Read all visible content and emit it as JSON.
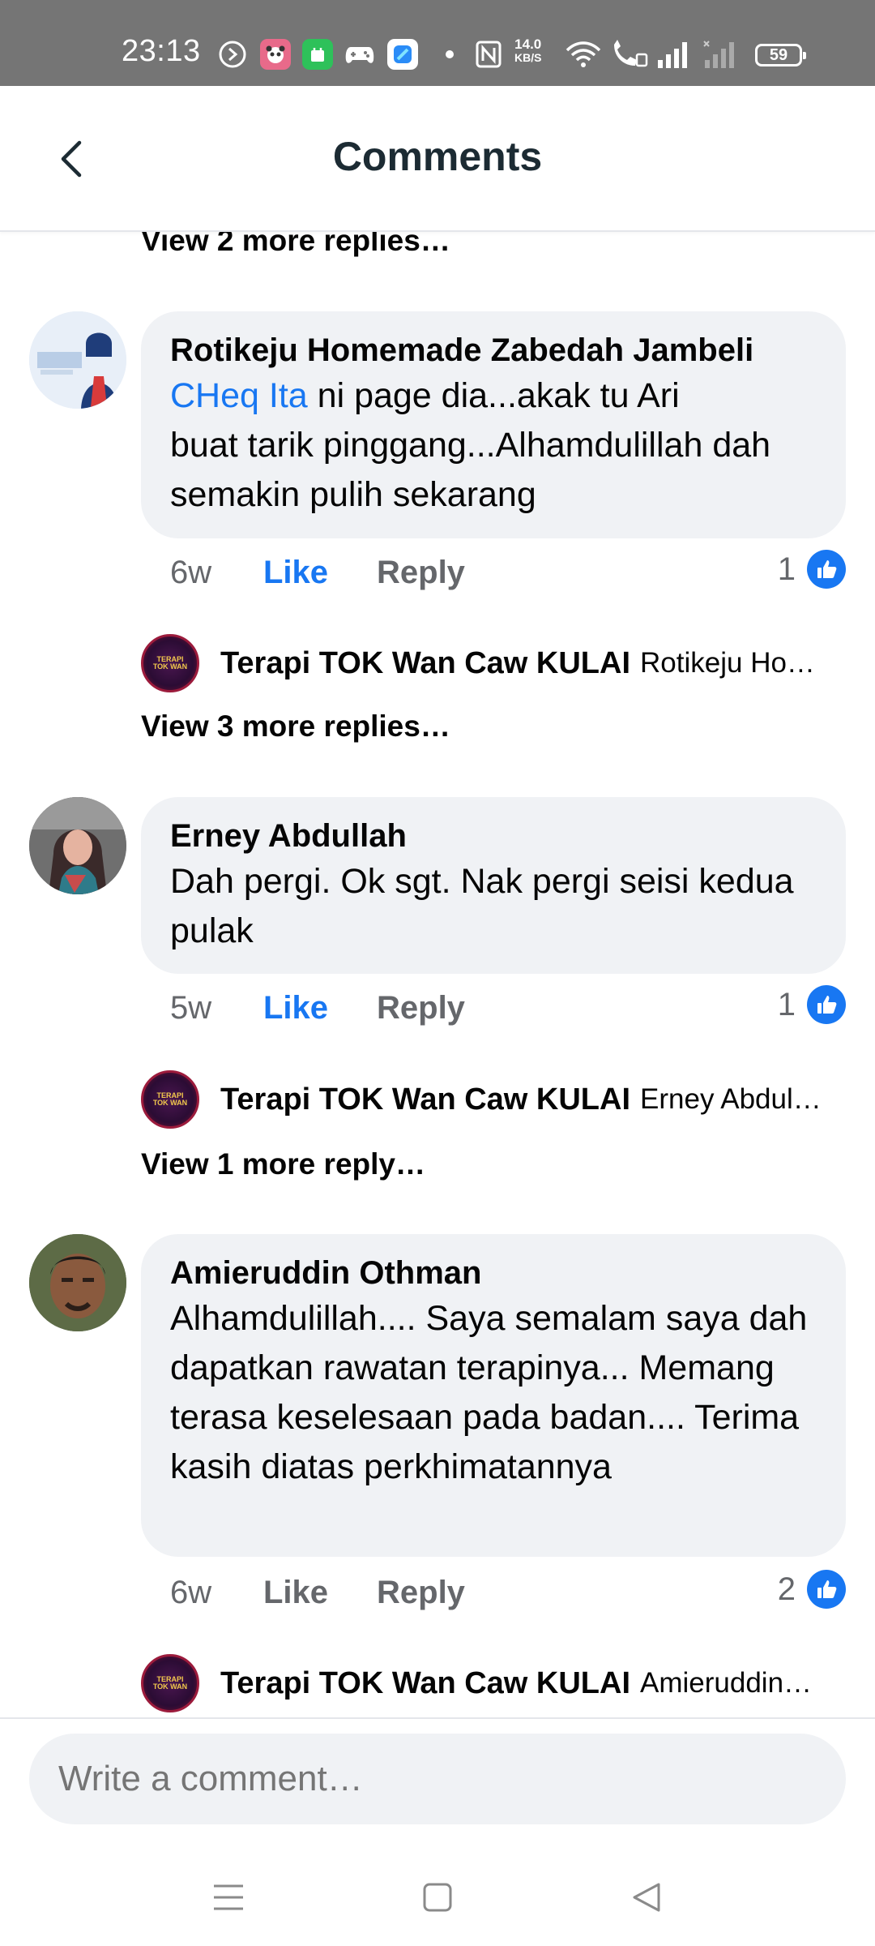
{
  "status_bar": {
    "time": "23:13",
    "speed_value": "14.0",
    "speed_unit": "KB/S",
    "battery": "59",
    "icons": [
      "clock-icon",
      "panda-app-icon",
      "green-app-icon",
      "gamepad-icon",
      "blue-app-icon",
      "nfc-icon",
      "wifi-icon",
      "wifi-call-icon",
      "signal-icon",
      "signal-weak-icon",
      "battery-icon"
    ]
  },
  "header": {
    "title": "Comments",
    "back_icon": "chevron-left-icon"
  },
  "threads": [
    {
      "view_more_above": "View 2 more replies…",
      "author": "Rotikeju Homemade Zabedah Jambeli",
      "mention": "CHeq Ita",
      "text_line1": " ni page dia...akak tu Ari",
      "text_rest": "buat tarik pinggang...Alhamdulillah dah semakin pulih sekarang",
      "time": "6w",
      "like_label": "Like",
      "reply_label": "Reply",
      "reaction_count": "1",
      "reply_author": "Terapi TOK Wan Caw KULAI",
      "reply_snippet": "Rotikeju Ho…",
      "view_more_below": "View 3 more replies…"
    },
    {
      "author": "Erney Abdullah",
      "text": "Dah pergi. Ok sgt.  Nak pergi seisi kedua pulak",
      "time": "5w",
      "like_label": "Like",
      "reply_label": "Reply",
      "reaction_count": "1",
      "reply_author": "Terapi TOK Wan Caw KULAI",
      "reply_snippet": "Erney Abdul…",
      "view_more_below": "View 1 more reply…"
    },
    {
      "author": "Amieruddin Othman",
      "text": "Alhamdulillah.... Saya semalam saya dah dapatkan rawatan terapinya... Memang terasa keselesaan pada badan.... Terima kasih diatas perkhimatannya",
      "time": "6w",
      "like_label": "Like",
      "reply_label": "Reply",
      "reaction_count": "2",
      "reply_author": "Terapi TOK Wan Caw KULAI",
      "reply_snippet": "Amieruddin…"
    }
  ],
  "composer": {
    "placeholder": "Write a comment…"
  },
  "nav": {
    "icons": [
      "menu-icon",
      "home-square-icon",
      "back-triangle-icon"
    ]
  },
  "colors": {
    "accent": "#1877f2",
    "bubble": "#f0f2f5",
    "status_bar": "#757575",
    "muted_text": "#65676b"
  }
}
